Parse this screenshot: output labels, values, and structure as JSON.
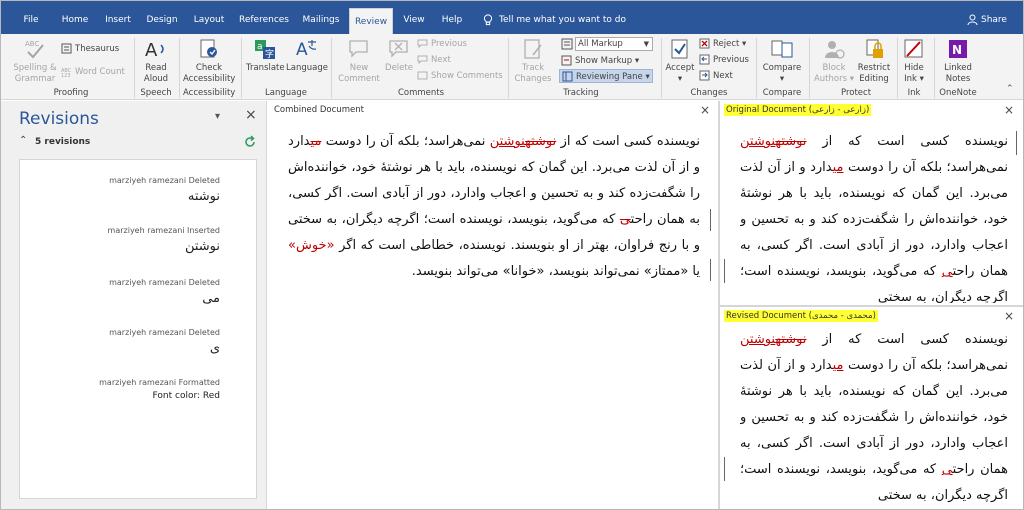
{
  "tabs": [
    "File",
    "Home",
    "Insert",
    "Design",
    "Layout",
    "References",
    "Mailings",
    "Review",
    "View",
    "Help"
  ],
  "tell_me": "Tell me what you want to do",
  "share": "Share",
  "ribbon": {
    "proofing": {
      "spelling": "Spelling &",
      "grammar": "Grammar",
      "thesaurus": "Thesaurus",
      "word_count": "Word Count",
      "label": "Proofing"
    },
    "speech": {
      "read": "Read",
      "aloud": "Aloud",
      "label": "Speech"
    },
    "accessibility": {
      "check": "Check",
      "acc": "Accessibility",
      "label": "Accessibility"
    },
    "language": {
      "translate": "Translate",
      "language": "Language",
      "label": "Language"
    },
    "comments": {
      "new": "New",
      "comment": "Comment",
      "delete": "Delete",
      "previous": "Previous",
      "next": "Next",
      "show": "Show Comments",
      "label": "Comments"
    },
    "tracking": {
      "track": "Track",
      "changes": "Changes",
      "markup_value": "All Markup",
      "show_markup": "Show Markup",
      "reviewing_pane": "Reviewing Pane",
      "label": "Tracking"
    },
    "changes": {
      "accept": "Accept",
      "reject": "Reject",
      "previous": "Previous",
      "next": "Next",
      "label": "Changes"
    },
    "compare": {
      "compare": "Compare",
      "label": "Compare"
    },
    "protect": {
      "block": "Block",
      "authors": "Authors",
      "restrict": "Restrict",
      "editing": "Editing",
      "label": "Protect"
    },
    "ink": {
      "hide": "Hide",
      "ink": "Ink",
      "label": "Ink"
    },
    "onenote": {
      "linked": "Linked",
      "notes": "Notes",
      "label": "OneNote"
    }
  },
  "revisions": {
    "title": "Revisions",
    "count": "5 revisions",
    "items": [
      {
        "meta": "marziyeh ramezani Deleted",
        "text": "نوشته"
      },
      {
        "meta": "marziyeh ramezani Inserted",
        "text": "نوشتن"
      },
      {
        "meta": "marziyeh ramezani Deleted",
        "text": "می"
      },
      {
        "meta": "marziyeh ramezani Deleted",
        "text": "ی"
      },
      {
        "meta": "marziyeh ramezani Formatted",
        "text": "Font color: Red"
      }
    ]
  },
  "combined": {
    "label": "Combined Document",
    "before_del": "نویسنده کسی است که از ",
    "deleted": "نوشته",
    "inserted": "نوشتن",
    "after_ins": " نمی‌هراسد؛ بلکه آن را دوست ",
    "mi": "می",
    "after_mi": "دارد و از آن لذت می‌برد. این گمان که نویسنده، باید با هر نوشتهٔ خود، خواننده‌اش را شگفت‌زده کند و به تحسین و اعجاب وادارد، دور از آبادی است. اگر کسی، به همان راحت",
    "ye": "ی",
    "after_ye": " که می‌گوید، بنویسد، نویسنده است؛ اگرچه دیگران، به سختی و با رنج فراوان، بهتر از او بنویسند. نویسنده، خطاطی است که اگر ",
    "khosh": "«خوش»",
    "tail": " یا «ممتاز» نمی‌تواند بنویسد، «خوانا» می‌تواند بنویسد."
  },
  "original": {
    "label": "Original Document (زارعی - زارعی)",
    "before": "نویسنده کسی است که از ",
    "deleted": "نوشته",
    "inserted": "نوشتن",
    "after_ins": " نمی‌هراسد؛ بلکه آن را دوست ",
    "mi": "می",
    "after_mi": "دارد و از آن لذت می‌برد. این گمان که نویسنده، باید با هر نوشتهٔ خود، خواننده‌اش را شگفت‌زده کند و به تحسین و اعجاب وادارد، دور از آبادی است. اگر کسی، به همان راحت",
    "ye": "ی",
    "tail": " که می‌گوید، بنویسد، نویسنده است؛ اگرچه دیگران، به سختی"
  },
  "revised": {
    "label": "Revised Document (محمدی - محمدی)",
    "before": "نویسنده کسی است که از ",
    "deleted": "نوشته",
    "inserted": "نوشتن",
    "after_ins": " نمی‌هراسد؛ بلکه آن را دوست ",
    "mi": "می",
    "after_mi": "دارد و از آن لذت می‌برد. این گمان که نویسنده، باید با هر نوشتهٔ خود، خواننده‌اش را شگفت‌زده کند و به تحسین و اعجاب وادارد، دور از آبادی است. اگر کسی، به همان راحت",
    "ye": "ی",
    "tail": " که می‌گوید، بنویسد، نویسنده است؛ اگرچه دیگران، به سختی"
  },
  "colors": {
    "accent": "#2b579a",
    "revision_red": "#c00000",
    "highlight": "#ffff33"
  },
  "close_glyph": "×",
  "pane_menu_glyph": "▾"
}
